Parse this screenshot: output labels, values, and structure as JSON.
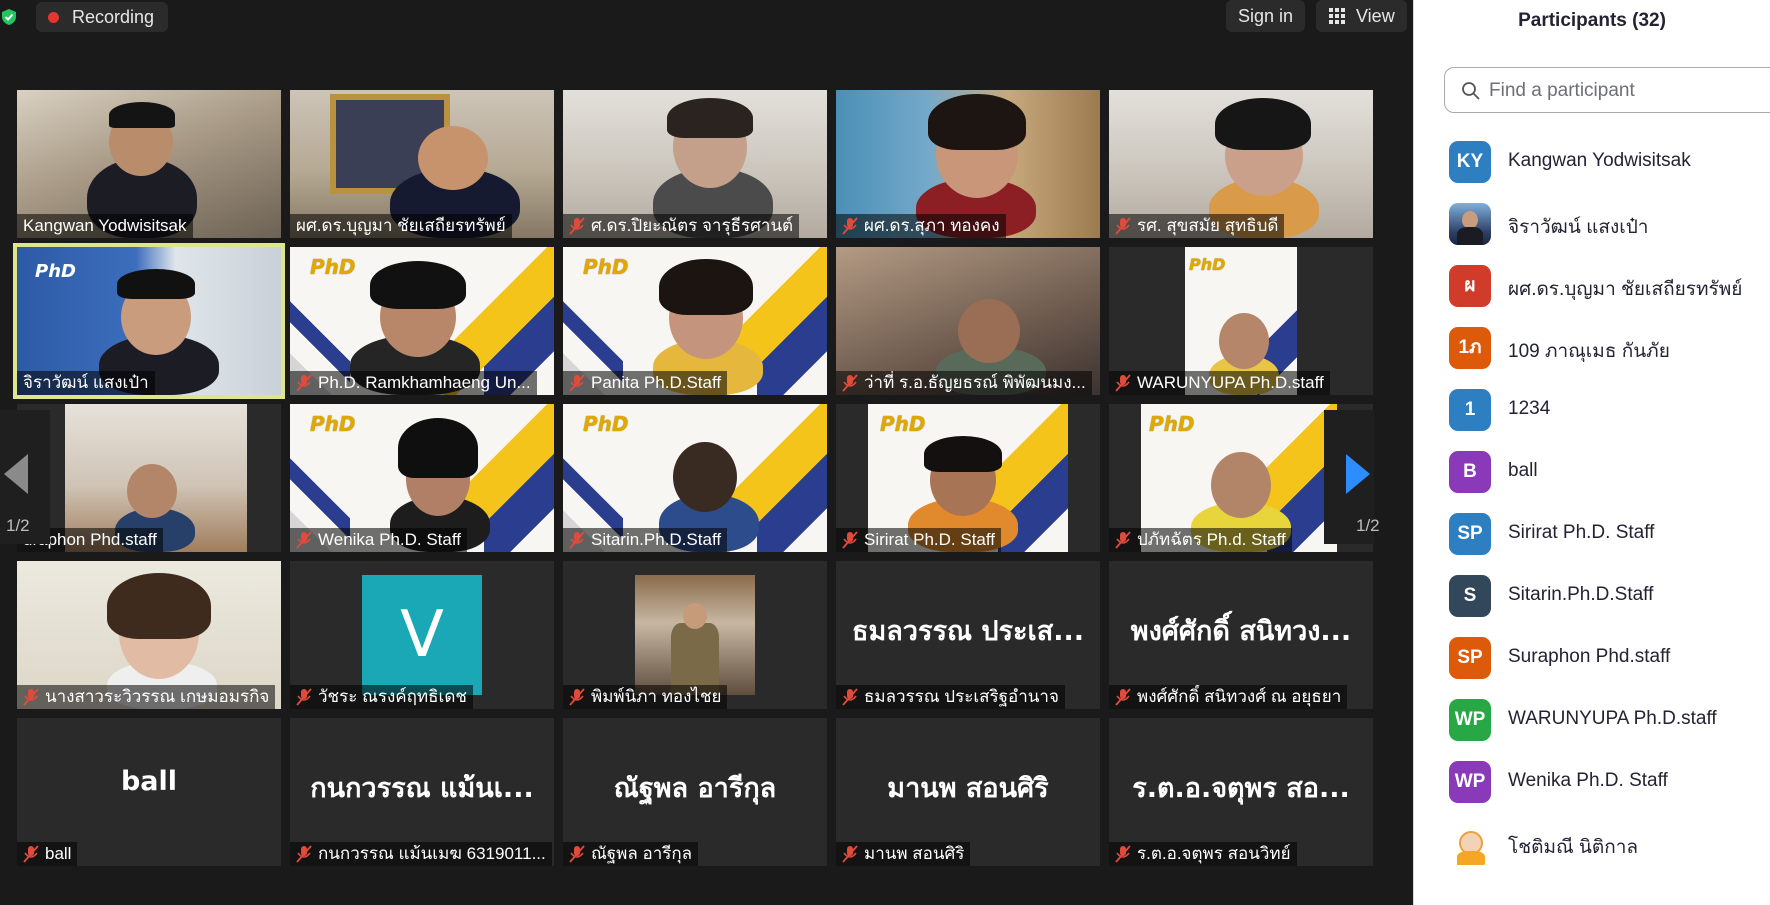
{
  "topbar": {
    "recording_label": "Recording",
    "signin_label": "Sign in",
    "view_label": "View",
    "colors": {
      "recording_dot": "#e5352f",
      "shield": "#22c55e"
    }
  },
  "gallery": {
    "page_left": "1/2",
    "page_right": "1/2",
    "tiles": [
      {
        "name": "Kangwan Yodwisitsak",
        "muted": false
      },
      {
        "name": "ผศ.ดร.บุญมา ชัยเสถียรทรัพย์",
        "muted": false
      },
      {
        "name": "ศ.ดร.ปิยะณัตร จารุธีรศานต์",
        "muted": true
      },
      {
        "name": "ผศ.ดร.สุภา  ทองคง",
        "muted": true
      },
      {
        "name": "รศ. สุขสมัย สุทธิบดี",
        "muted": true
      },
      {
        "name": "จิราวัฒน์ แสงเป๋า",
        "muted": false,
        "active": true
      },
      {
        "name": "Ph.D. Ramkhamhaeng Un...",
        "muted": true
      },
      {
        "name": "Panita Ph.D.Staff",
        "muted": true
      },
      {
        "name": "ว่าที่ ร.อ.ธัญยธรณ์ พิพัฒนมง...",
        "muted": true
      },
      {
        "name": "WARUNYUPA Ph.D.staff",
        "muted": true
      },
      {
        "name": "uraphon Phd.staff",
        "muted": true
      },
      {
        "name": "Wenika Ph.D. Staff",
        "muted": true
      },
      {
        "name": "Sitarin.Ph.D.Staff",
        "muted": true
      },
      {
        "name": "Sirirat Ph.D. Staff",
        "muted": true
      },
      {
        "name": "ปภัทฉัตร Ph.d. Staff",
        "muted": true
      },
      {
        "name": "นางสาวระวิวรรณ เกษมอมรกิจ",
        "muted": true
      },
      {
        "name": "วัชระ ณรงค์ฤทธิเดช",
        "muted": true,
        "avatar_letter": "V"
      },
      {
        "name": "พิมพ์นิภา ทองไชย",
        "muted": true
      },
      {
        "name": "ธมลวรรณ ประเสริฐอำนาจ",
        "muted": true,
        "big": "ธมลวรรณ ประเส..."
      },
      {
        "name": "พงศ์ศักดิ์ สนิทวงศ์ ณ อยุธยา",
        "muted": true,
        "big": "พงศ์ศักดิ์ สนิทวง..."
      },
      {
        "name": "ball",
        "muted": true,
        "big": "ball"
      },
      {
        "name": "กนกวรรณ แม้นเมฆ 6319011...",
        "muted": true,
        "big": "กนกวรรณ แม้นเ..."
      },
      {
        "name": "ณัฐพล อารีกุล",
        "muted": true,
        "big": "ณัฐพล อารีกุล"
      },
      {
        "name": "มานพ สอนศิริ",
        "muted": true,
        "big": "มานพ สอนศิริ"
      },
      {
        "name": "ร.ต.อ.จตุพร  สอนวิทย์",
        "muted": true,
        "big": "ร.ต.อ.จตุพร  สอ..."
      }
    ]
  },
  "participants": {
    "title": "Participants (32)",
    "search_placeholder": "Find a participant",
    "list": [
      {
        "initials": "KY",
        "name": "Kangwan Yodwisitsak",
        "color": "#2d7fc1"
      },
      {
        "initials": "",
        "name": "จิราวัฒน์ แสงเป๋า",
        "color": "photo"
      },
      {
        "initials": "ผ",
        "name": "ผศ.ดร.บุญมา ชัยเสถียรทรัพย์",
        "color": "#d13b2a"
      },
      {
        "initials": "1ภ",
        "name": "109 ภาณุเมธ กันภัย",
        "color": "#dd5a0a"
      },
      {
        "initials": "1",
        "name": "1234",
        "color": "#2d7fc1"
      },
      {
        "initials": "B",
        "name": "ball",
        "color": "#8a3ab9"
      },
      {
        "initials": "SP",
        "name": "Sirirat Ph.D. Staff",
        "color": "#2d7fc1"
      },
      {
        "initials": "S",
        "name": "Sitarin.Ph.D.Staff",
        "color": "#33475b"
      },
      {
        "initials": "SP",
        "name": "Suraphon Phd.staff",
        "color": "#dd5a0a"
      },
      {
        "initials": "WP",
        "name": "WARUNYUPA Ph.D.staff",
        "color": "#28a745"
      },
      {
        "initials": "WP",
        "name": "Wenika Ph.D. Staff",
        "color": "#8a3ab9"
      },
      {
        "initials": "",
        "name": "โชติมณี นิติกาล",
        "color": "cartoon"
      }
    ]
  }
}
